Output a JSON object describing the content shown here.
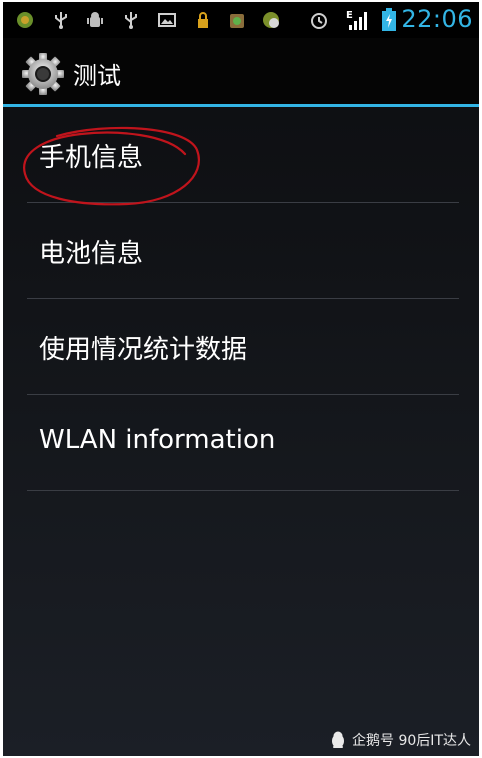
{
  "status_bar": {
    "time": "22:06",
    "network_label": "E",
    "icons": [
      "app-notification-icon",
      "usb-icon",
      "android-debug-icon",
      "usb-icon",
      "image-icon",
      "lock-icon",
      "store-icon",
      "app-notification-icon",
      "alarm-icon",
      "signal-icon",
      "battery-charging-icon"
    ]
  },
  "action_bar": {
    "icon": "settings-gear-icon",
    "title": "测试"
  },
  "list": {
    "items": [
      {
        "label": "手机信息"
      },
      {
        "label": "电池信息"
      },
      {
        "label": "使用情况统计数据"
      },
      {
        "label": "WLAN information"
      }
    ]
  },
  "watermark": {
    "text": "企鹅号 90后IT达人",
    "icon": "penguin-icon"
  },
  "colors": {
    "accent": "#33b5e5",
    "annotation": "#c0141c"
  }
}
